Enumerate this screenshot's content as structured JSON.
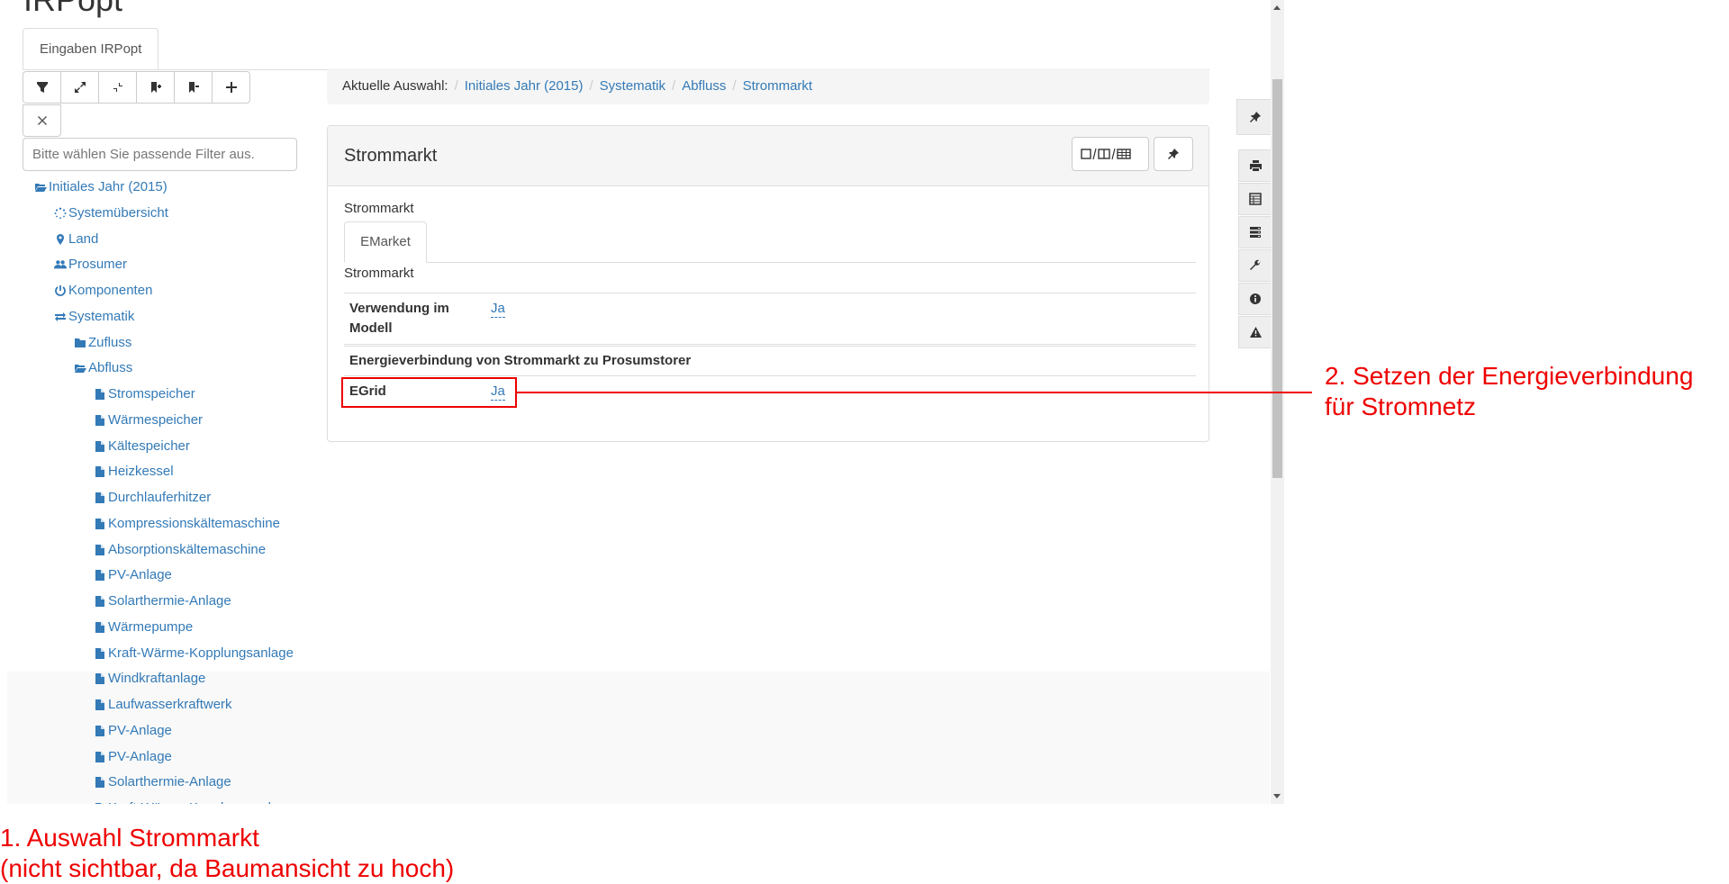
{
  "app": {
    "title": "IRPopt",
    "tab": "Eingaben IRPopt"
  },
  "tree_toolbar": {
    "buttons": [
      "filter-icon",
      "expand-icon",
      "collapse-icon",
      "bookmark-plus-icon",
      "bookmark-minus-icon",
      "plus-icon"
    ],
    "clear_icon": "times-icon",
    "filter_placeholder": "Bitte wählen Sie passende Filter aus."
  },
  "tree": {
    "root": "Initiales Jahr (2015)",
    "level1": [
      "Systemübersicht",
      "Land",
      "Prosumer",
      "Komponenten",
      "Systematik"
    ],
    "level2": [
      "Zufluss",
      "Abfluss"
    ],
    "level3": [
      "Stromspeicher",
      "Wärmespeicher",
      "Kältespeicher",
      "Heizkessel",
      "Durchlauferhitzer",
      "Kompressionskältemaschine",
      "Absorptionskältemaschine",
      "PV-Anlage",
      "Solarthermie-Anlage",
      "Wärmepumpe",
      "Kraft-Wärme-Kopplungsanlage",
      "Windkraftanlage",
      "Laufwasserkraftwerk",
      "PV-Anlage",
      "PV-Anlage",
      "Solarthermie-Anlage",
      "Kraft-Wärme-Kopplungsanlage"
    ]
  },
  "breadcrumb": {
    "label": "Aktuelle Auswahl:",
    "items": [
      "Initiales Jahr (2015)",
      "Systematik",
      "Abfluss",
      "Strommarkt"
    ],
    "separator": "/"
  },
  "panel": {
    "title": "Strommarkt",
    "section_label": "Strommarkt",
    "sub_tab": "EMarket",
    "sub_label": "Strommarkt",
    "row1_label_line1": "Verwendung im",
    "row1_label_line2": "Modell",
    "row1_value": "Ja",
    "group_heading": "Energieverbindung von Strommarkt zu Prosumstorer",
    "row2_label": "EGrid",
    "row2_value": "Ja"
  },
  "side_tools": [
    "thumbtack-icon",
    "print-icon",
    "table-icon",
    "server-icon",
    "wrench-icon",
    "info-icon",
    "warning-icon"
  ],
  "annotations": {
    "one_line1": "1. Auswahl Strommarkt",
    "one_line2": "(nicht sichtbar, da Baumansicht zu hoch)",
    "two_line1": "2. Setzen der Energieverbindung",
    "two_line2": "für Stromnetz"
  },
  "colors": {
    "link": "#337ab7",
    "annotation": "#ee0000"
  }
}
